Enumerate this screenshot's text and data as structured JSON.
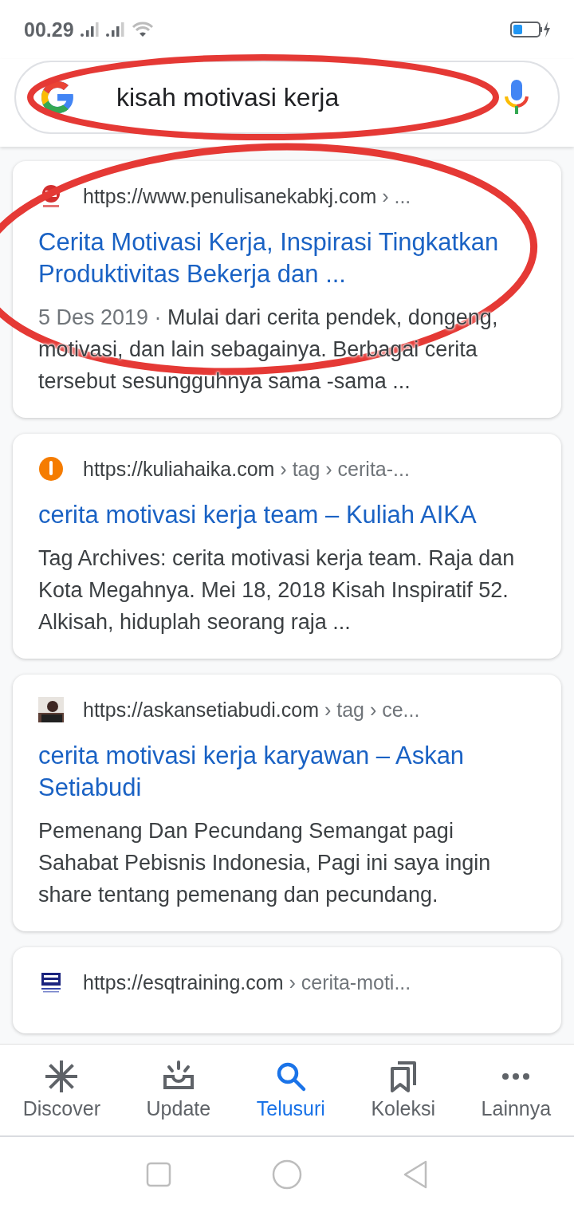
{
  "status_bar": {
    "time": "00.29"
  },
  "search": {
    "value": "kisah motivasi kerja"
  },
  "results": [
    {
      "kind": "emblem",
      "url_host": "https://www.penulisanekabkj.com",
      "url_path": "› ...",
      "title": "Cerita Motivasi Kerja, Inspirasi Tingkatkan Produktivitas Bekerja dan ...",
      "date": "5 Des 2019 ·",
      "snippet": "Mulai dari cerita pendek, dongeng, motivasi, dan lain sebagainya. Berbagai cerita tersebut sesungguhnya sama -sama ..."
    },
    {
      "kind": "dot",
      "url_host": "https://kuliahaika.com",
      "url_path": "› tag › cerita-...",
      "title": "cerita motivasi kerja team – Kuliah AIKA",
      "snippet": "Tag Archives: cerita motivasi kerja team. Raja dan Kota Megahnya. Mei 18, 2018 Kisah Inspiratif 52. Alkisah, hiduplah seorang raja ..."
    },
    {
      "url_host": "https://askansetiabudi.com",
      "url_path": "› tag › ce...",
      "title": "cerita motivasi kerja karyawan – Askan Setiabudi",
      "snippet": "Pemenang Dan Pecundang Semangat pagi Sahabat Pebisnis Indonesia, Pagi ini saya ingin share tentang pemenang dan pecundang."
    },
    {
      "kind": "logo",
      "url_host": "https://esqtraining.com",
      "url_path": "› cerita-moti..."
    }
  ],
  "bottom_nav": [
    {
      "label": "Discover",
      "selected": false
    },
    {
      "label": "Update",
      "selected": false
    },
    {
      "label": "Telusuri",
      "selected": true
    },
    {
      "label": "Koleksi",
      "selected": false
    },
    {
      "label": "Lainnya",
      "selected": false
    }
  ]
}
